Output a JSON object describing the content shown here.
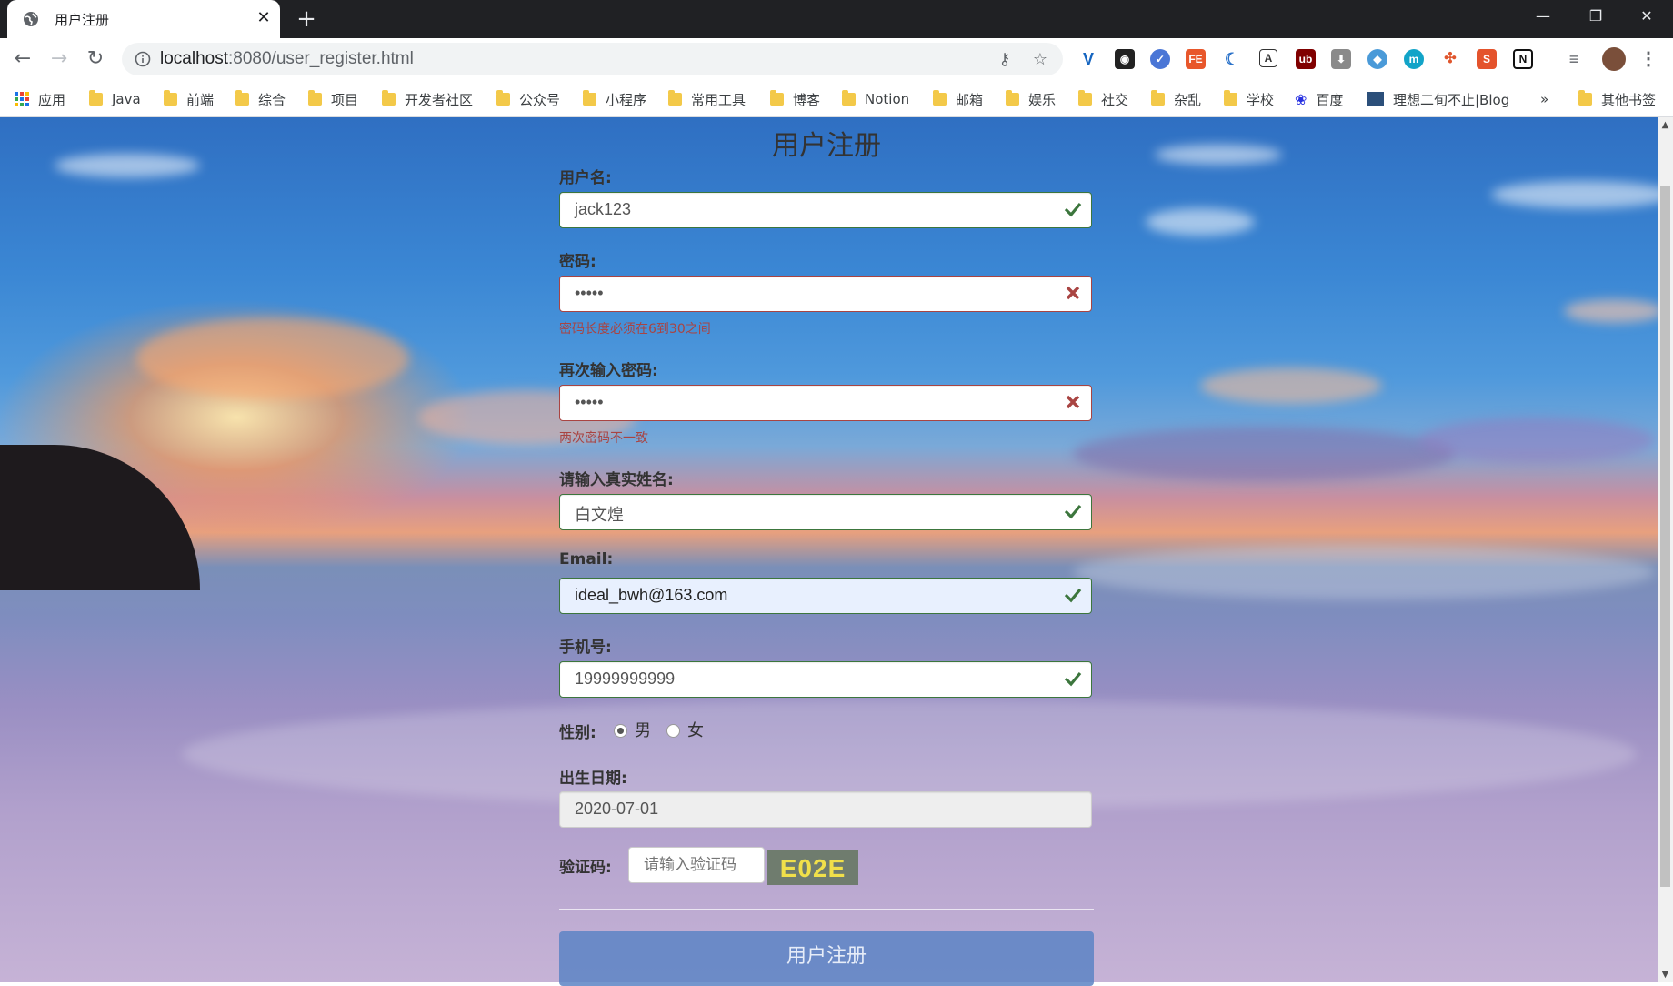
{
  "browser": {
    "tab_title": "用户注册",
    "url_host": "localhost",
    "url_rest": ":8080/user_register.html",
    "bookmarks": [
      {
        "label": "应用",
        "icon": "apps-grid-icon"
      },
      {
        "label": "Java",
        "icon": "folder-icon"
      },
      {
        "label": "前端",
        "icon": "folder-icon"
      },
      {
        "label": "综合",
        "icon": "folder-icon"
      },
      {
        "label": "项目",
        "icon": "folder-icon"
      },
      {
        "label": "开发者社区",
        "icon": "folder-icon"
      },
      {
        "label": "公众号",
        "icon": "folder-icon"
      },
      {
        "label": "小程序",
        "icon": "folder-icon"
      },
      {
        "label": "常用工具",
        "icon": "folder-icon"
      },
      {
        "label": "博客",
        "icon": "folder-icon"
      },
      {
        "label": "Notion",
        "icon": "folder-icon"
      },
      {
        "label": "邮箱",
        "icon": "folder-icon"
      },
      {
        "label": "娱乐",
        "icon": "folder-icon"
      },
      {
        "label": "社交",
        "icon": "folder-icon"
      },
      {
        "label": "杂乱",
        "icon": "folder-icon"
      },
      {
        "label": "学校",
        "icon": "folder-icon"
      },
      {
        "label": "百度",
        "icon": "baidu-paw-icon"
      },
      {
        "label": "理想二旬不止|Blog",
        "icon": "blog-thumbnail-icon"
      },
      {
        "label": "»",
        "icon": "overflow-chevron-icon"
      },
      {
        "label": "其他书签",
        "icon": "folder-icon"
      }
    ]
  },
  "form": {
    "title": "用户注册",
    "username": {
      "label": "用户名:",
      "value": "jack123",
      "status": "success"
    },
    "password": {
      "label": "密码:",
      "value": "•••••",
      "status": "error",
      "help": "密码长度必须在6到30之间"
    },
    "password_confirm": {
      "label": "再次输入密码:",
      "value": "•••••",
      "status": "error",
      "help": "两次密码不一致"
    },
    "real_name": {
      "label": "请输入真实姓名:",
      "value": "白文煌",
      "status": "success"
    },
    "email": {
      "label": "Email:",
      "value": "ideal_bwh@163.com",
      "status": "success"
    },
    "phone": {
      "label": "手机号:",
      "value": "19999999999",
      "status": "success"
    },
    "gender": {
      "label": "性别:",
      "options": [
        "男",
        "女"
      ],
      "selected": "男"
    },
    "birthday": {
      "label": "出生日期:",
      "value": "2020-07-01"
    },
    "captcha": {
      "label": "验证码:",
      "placeholder": "请输入验证码",
      "code": "E02E"
    },
    "submit_label": "用户注册"
  },
  "colors": {
    "success": "#3c763d",
    "error": "#a94442",
    "submit_bg": "#5c84c4",
    "captcha_bg": "#6f7c6e",
    "captcha_text": "#f1e04a"
  }
}
